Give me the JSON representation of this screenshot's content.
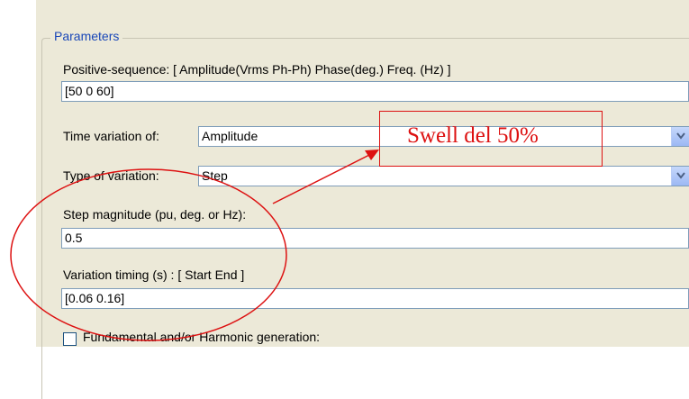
{
  "group": {
    "legend": "Parameters"
  },
  "positive_sequence": {
    "label": "Positive-sequence: [ Amplitude(Vrms Ph-Ph)  Phase(deg.)   Freq. (Hz) ]",
    "value": "[50 0 60]"
  },
  "time_variation": {
    "label": "Time variation of:",
    "selected": "Amplitude"
  },
  "type_variation": {
    "label": "Type of variation:",
    "selected": "Step"
  },
  "step_magnitude": {
    "label": "Step magnitude (pu, deg. or Hz):",
    "value": "0.5"
  },
  "variation_timing": {
    "label": "Variation timing (s) : [ Start   End ]",
    "value": "[0.06 0.16]"
  },
  "harmonic": {
    "label": "Fundamental and/or Harmonic generation:",
    "checked": false
  },
  "annotation": {
    "text": "Swell del 50%",
    "color": "#dd1111"
  }
}
